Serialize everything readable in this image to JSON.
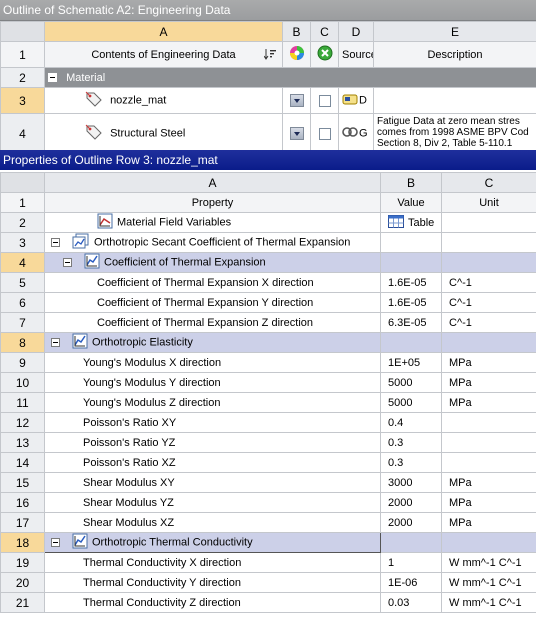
{
  "top_panel": {
    "title": "Outline of Schematic A2: Engineering Data",
    "columns": [
      "A",
      "B",
      "C",
      "D",
      "E"
    ],
    "header_row": {
      "num": "1",
      "contents": "Contents of Engineering Data",
      "source": "Source",
      "description": "Description"
    },
    "category_row": {
      "num": "2",
      "label": "Material"
    },
    "row3": {
      "num": "3",
      "name": "nozzle_mat",
      "source_text": "D"
    },
    "row4": {
      "num": "4",
      "name": "Structural Steel",
      "source_text": "G",
      "description_lines": [
        "Fatigue Data at zero mean stres",
        "comes from 1998 ASME BPV Cod",
        "Section 8, Div 2, Table 5-110.1"
      ]
    }
  },
  "props_panel": {
    "title": "Properties of Outline Row 3: nozzle_mat",
    "columns": [
      "A",
      "B",
      "C"
    ],
    "header_row": {
      "num": "1",
      "property": "Property",
      "value": "Value",
      "unit": "Unit"
    },
    "rows": [
      {
        "num": "2",
        "name": "Material Field Variables",
        "value": "Table",
        "unit": ""
      },
      {
        "num": "3",
        "name": "Orthotropic Secant Coefficient of Thermal Expansion",
        "value": "",
        "unit": ""
      },
      {
        "num": "4",
        "name": "Coefficient of Thermal Expansion",
        "value": "",
        "unit": ""
      },
      {
        "num": "5",
        "name": "Coefficient of Thermal Expansion X direction",
        "value": "1.6E-05",
        "unit": "C^-1"
      },
      {
        "num": "6",
        "name": "Coefficient of Thermal Expansion Y direction",
        "value": "1.6E-05",
        "unit": "C^-1"
      },
      {
        "num": "7",
        "name": "Coefficient of Thermal Expansion Z direction",
        "value": "6.3E-05",
        "unit": "C^-1"
      },
      {
        "num": "8",
        "name": "Orthotropic Elasticity",
        "value": "",
        "unit": ""
      },
      {
        "num": "9",
        "name": "Young's Modulus X direction",
        "value": "1E+05",
        "unit": "MPa"
      },
      {
        "num": "10",
        "name": "Young's Modulus Y direction",
        "value": "5000",
        "unit": "MPa"
      },
      {
        "num": "11",
        "name": "Young's Modulus Z direction",
        "value": "5000",
        "unit": "MPa"
      },
      {
        "num": "12",
        "name": "Poisson's Ratio XY",
        "value": "0.4",
        "unit": ""
      },
      {
        "num": "13",
        "name": "Poisson's Ratio YZ",
        "value": "0.3",
        "unit": ""
      },
      {
        "num": "14",
        "name": "Poisson's Ratio XZ",
        "value": "0.3",
        "unit": ""
      },
      {
        "num": "15",
        "name": "Shear Modulus XY",
        "value": "3000",
        "unit": "MPa"
      },
      {
        "num": "16",
        "name": "Shear Modulus YZ",
        "value": "2000",
        "unit": "MPa"
      },
      {
        "num": "17",
        "name": "Shear Modulus XZ",
        "value": "2000",
        "unit": "MPa"
      },
      {
        "num": "18",
        "name": "Orthotropic Thermal Conductivity",
        "value": "",
        "unit": ""
      },
      {
        "num": "19",
        "name": "Thermal Conductivity X direction",
        "value": "1",
        "unit": "W mm^-1 C^-1"
      },
      {
        "num": "20",
        "name": "Thermal Conductivity Y direction",
        "value": "1E-06",
        "unit": "W mm^-1 C^-1"
      },
      {
        "num": "21",
        "name": "Thermal Conductivity Z direction",
        "value": "0.03",
        "unit": "W mm^-1 C^-1"
      }
    ]
  },
  "icons": {
    "sort": "sort-icon",
    "color_wheel": "color-wheel-icon",
    "suppress": "suppress-icon",
    "material_tag": "material-tag-icon",
    "library": "library-icon",
    "property_chart": "property-chart-icon",
    "table": "table-icon"
  },
  "colors": {
    "selected_row_header": "#f8d99a",
    "group_row": "#ccd0e8",
    "category_row": "#8e9195",
    "props_title_bar": "#0a1c8a"
  }
}
